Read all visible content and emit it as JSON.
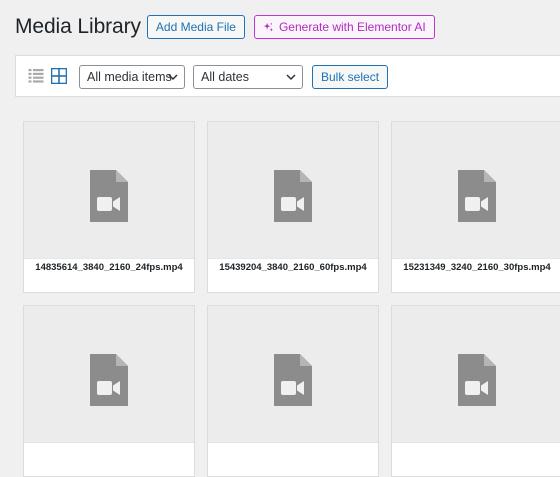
{
  "header": {
    "title": "Media Library",
    "add_button_label": "Add Media File",
    "ai_button_label": "Generate with Elementor AI"
  },
  "toolbar": {
    "list_view_icon": "list-view-icon",
    "grid_view_icon": "grid-view-icon",
    "type_filter_value": "All media items",
    "date_filter_value": "All dates",
    "bulk_select_label": "Bulk select"
  },
  "media": {
    "items": [
      {
        "filename": "14835614_3840_2160_24fps.mp4",
        "icon": "video-file-icon"
      },
      {
        "filename": "15439204_3840_2160_60fps.mp4",
        "icon": "video-file-icon"
      },
      {
        "filename": "15231349_3240_2160_30fps.mp4",
        "icon": "video-file-icon"
      },
      {
        "filename": "",
        "icon": "video-file-icon"
      },
      {
        "filename": "",
        "icon": "video-file-icon"
      },
      {
        "filename": "",
        "icon": "video-file-icon"
      }
    ]
  },
  "colors": {
    "primary": "#2271b1",
    "ai_accent": "#c036d2",
    "background": "#f0f0f1",
    "icon_gray": "#8c8c8c"
  }
}
